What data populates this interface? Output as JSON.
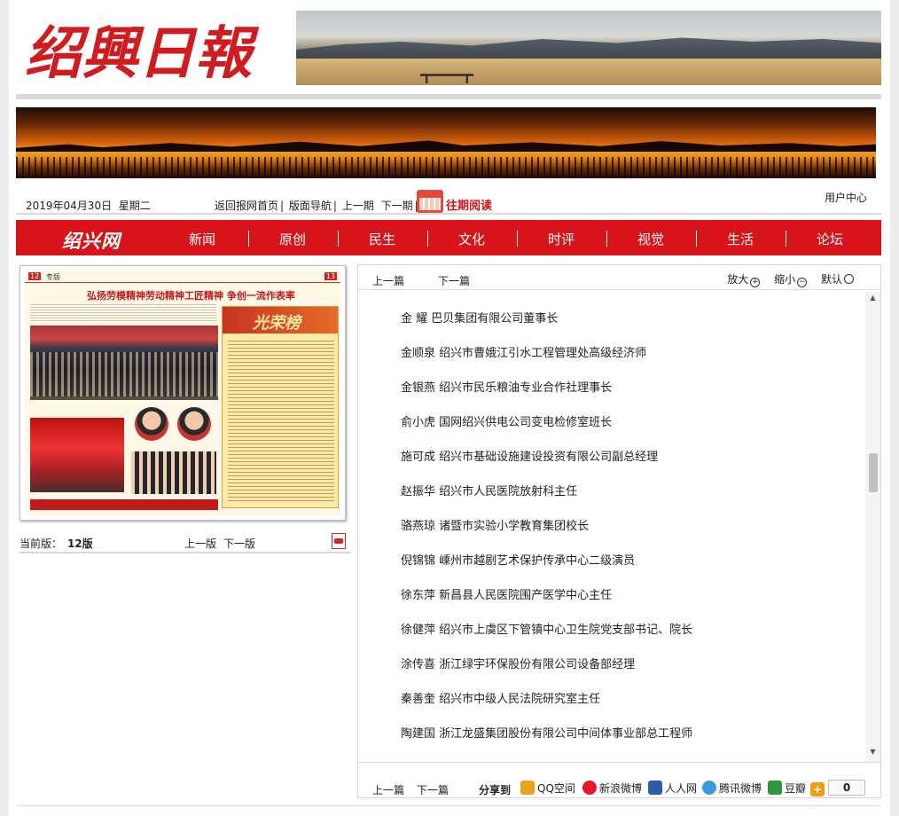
{
  "header": {
    "logo_text": "绍興日報"
  },
  "info": {
    "date": "2019年04月30日",
    "weekday": "星期二",
    "links": [
      {
        "label": "返回报网首页",
        "sep": "|"
      },
      {
        "label": "版面导航",
        "sep": "|"
      },
      {
        "label": "上一期",
        "sep": ""
      },
      {
        "label": "下一期",
        "sep": "|"
      }
    ],
    "past_reading": "往期阅读",
    "user_center": "用户中心"
  },
  "nav": {
    "logo": "绍兴网",
    "items": [
      "新闻",
      "原创",
      "民生",
      "文化",
      "时评",
      "视觉",
      "生活",
      "论坛"
    ]
  },
  "thumbnail": {
    "page_no": "12",
    "page_no_right": "13",
    "section": "专版",
    "headline": "弘扬劳模精神劳动精神工匠精神 争创一流作表率",
    "honor_title": "光荣榜"
  },
  "left_meta": {
    "current_label": "当前版：",
    "current_value": "12版",
    "prev": "上一版",
    "next": "下一版"
  },
  "article": {
    "prev": "上一篇",
    "next": "下一篇",
    "zoom_in": "放大",
    "zoom_out": "缩小",
    "zoom_default": "默认",
    "lines": [
      "金  耀  巴贝集团有限公司董事长",
      "金顺泉  绍兴市曹娥江引水工程管理处高级经济师",
      "金银燕  绍兴市民乐粮油专业合作社理事长",
      "俞小虎  国网绍兴供电公司变电检修室班长",
      "施可成  绍兴市基础设施建设投资有限公司副总经理",
      "赵振华  绍兴市人民医院放射科主任",
      "骆燕琼  诸暨市实验小学教育集团校长",
      "倪锦锦  嵊州市越剧艺术保护传承中心二级演员",
      "徐东萍  新昌县人民医院围产医学中心主任",
      "徐健萍  绍兴市上虞区下管镇中心卫生院党支部书记、院长",
      "涂传喜  浙江绿宇环保股份有限公司设备部经理",
      "秦善奎  绍兴市中级人民法院研究室主任",
      "陶建国  浙江龙盛集团股份有限公司中间体事业部总工程师"
    ],
    "bottom_prev": "上一篇",
    "bottom_next": "下一篇",
    "share_label": "分享到",
    "share_items": [
      {
        "label": "QQ空间",
        "color": "#e8a21c"
      },
      {
        "label": "新浪微博",
        "color": "#e6162d"
      },
      {
        "label": "人人网",
        "color": "#2a5ea8"
      },
      {
        "label": "腾讯微博",
        "color": "#3a9bd8"
      },
      {
        "label": "豆瓣",
        "color": "#2e963d"
      }
    ],
    "share_more_color": "#f39c12",
    "share_count": "0"
  }
}
